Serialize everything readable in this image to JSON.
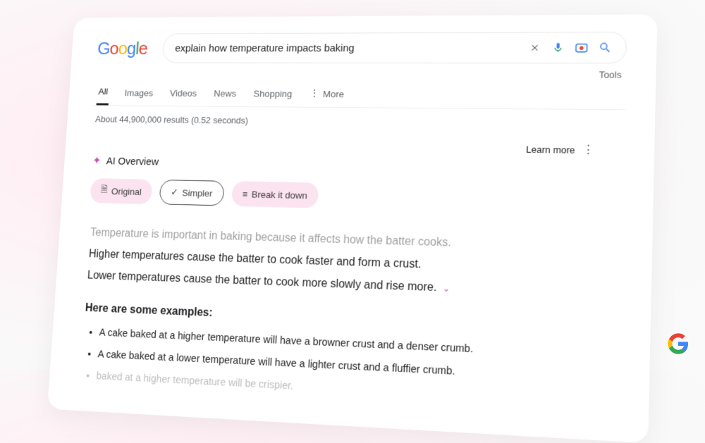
{
  "logo_text": "Google",
  "search": {
    "value": "explain how temperature impacts baking",
    "placeholder": ""
  },
  "tools_label": "Tools",
  "tabs": {
    "all": "All",
    "images": "Images",
    "videos": "Videos",
    "news": "News",
    "shopping": "Shopping",
    "more": "More"
  },
  "results_info": "About 44,900,000 results (0.52 seconds)",
  "learn_more": "Learn more",
  "ai_overview": {
    "title": "AI Overview",
    "chips": {
      "original": "Original",
      "simpler": "Simpler",
      "break_it_down": "Break it down"
    },
    "body": {
      "line1": "Temperature is important in baking because it affects how the batter cooks.",
      "line2": "Higher temperatures cause the batter to cook faster and form a crust.",
      "line3": "Lower temperatures cause the batter to cook more slowly and rise more."
    },
    "examples_heading": "Here are some examples:",
    "examples": {
      "e1": "A cake baked at a higher temperature will have a browner crust and a denser crumb.",
      "e2": "A cake baked at a lower temperature will have a lighter crust and a fluffier crumb.",
      "e3": "baked at a higher temperature will be crispier."
    }
  },
  "icons": {
    "clear": "close-icon",
    "mic": "mic-icon",
    "lens": "camera-icon",
    "search": "search-icon",
    "sparkle": "sparkle-icon",
    "kebab": "more-vert-icon",
    "doc": "document-icon",
    "check": "checklist-icon",
    "list": "list-icon",
    "chevron": "chevron-down-icon"
  },
  "colors": {
    "chip_bg": "#fbe3ef",
    "accent": "#c94fb7"
  }
}
